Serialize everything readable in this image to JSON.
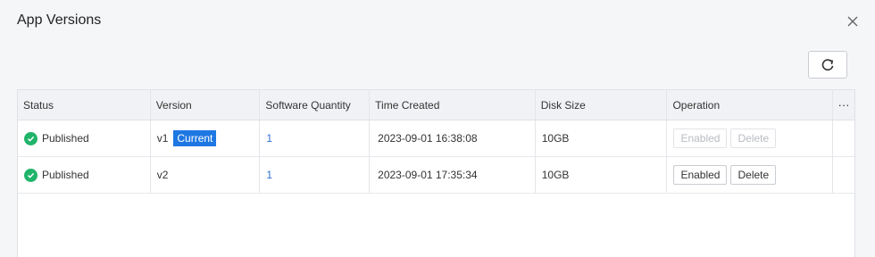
{
  "dialog": {
    "title": "App Versions"
  },
  "toolbar": {
    "refresh_icon": "refresh-icon"
  },
  "table": {
    "columns": [
      "Status",
      "Version",
      "Software Quantity",
      "Time Created",
      "Disk Size",
      "Operation"
    ],
    "more_label": "···",
    "rows": [
      {
        "status": "Published",
        "version": "v1",
        "badge": "Current",
        "software_quantity": "1",
        "time_created": "2023-09-01 16:38:08",
        "disk_size": "10GB",
        "enabled_label": "Enabled",
        "delete_label": "Delete",
        "actions_disabled": true
      },
      {
        "status": "Published",
        "version": "v2",
        "badge": "",
        "software_quantity": "1",
        "time_created": "2023-09-01 17:35:34",
        "disk_size": "10GB",
        "enabled_label": "Enabled",
        "delete_label": "Delete",
        "actions_disabled": false
      }
    ]
  },
  "colors": {
    "status_success": "#20b46a",
    "badge_bg": "#1e78e3",
    "link": "#2f6fd3"
  }
}
